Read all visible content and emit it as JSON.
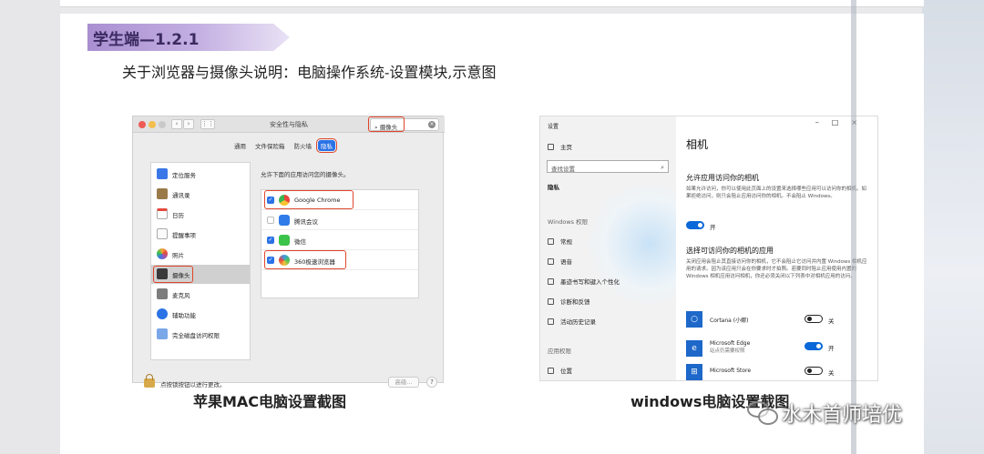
{
  "header": {
    "tag": "学生端—1.2.1",
    "subtitle": "关于浏览器与摄像头说明：电脑操作系统-设置模块,示意图"
  },
  "mac": {
    "window_title": "安全性与隐私",
    "search_value": "摄像头",
    "tabs": [
      "通用",
      "文件保险箱",
      "防火墙",
      "隐私"
    ],
    "active_tab": "隐私",
    "sidebar": [
      {
        "label": "定位服务",
        "color": "#3b78e7"
      },
      {
        "label": "通讯录",
        "color": "#9b7a4a"
      },
      {
        "label": "日历",
        "color": "#e44a3c"
      },
      {
        "label": "提醒事项",
        "color": "#f1f1f1"
      },
      {
        "label": "照片",
        "color": "#f3a53a"
      },
      {
        "label": "摄像头",
        "color": "#3a3a3a"
      },
      {
        "label": "麦克风",
        "color": "#7d7d7d"
      },
      {
        "label": "辅助功能",
        "color": "#2b72e6"
      },
      {
        "label": "完全磁盘访问权限",
        "color": "#7aa7e8"
      }
    ],
    "selected_sidebar": "摄像头",
    "main_label": "允许下面的应用访问您的摄像头。",
    "apps": [
      {
        "name": "Google Chrome",
        "checked": true,
        "color": "#e8453c"
      },
      {
        "name": "腾讯会议",
        "checked": false,
        "color": "#2f7be8"
      },
      {
        "name": "微信",
        "checked": true,
        "color": "#3cc34a"
      },
      {
        "name": "360极速浏览器",
        "checked": true,
        "color": "#3b9be8"
      }
    ],
    "footer_text": "点按锁按钮以进行更改。",
    "advanced_label": "高级...",
    "help_label": "?"
  },
  "captions": {
    "mac": "苹果MAC电脑设置截图",
    "windows": "windows电脑设置截图"
  },
  "win": {
    "window_title": "设置",
    "home": "主页",
    "search_placeholder": "查找设置",
    "privacy": "隐私",
    "windows_perms": "Windows 权限",
    "nav": [
      "常规",
      "语音",
      "墨迹书写和键入个性化",
      "诊断和反馈",
      "活动历史记录"
    ],
    "app_perms": "应用权限",
    "location": "位置",
    "page_title": "相机",
    "allow_heading": "允许应用访问你的相机",
    "allow_desc": "如果允许访问，你可以使用此页面上的设置来选择哪些应用可以访问你的相机。如果拒绝访问，则只会阻止应用访问你的相机。不会阻止 Windows。",
    "allow_toggle_label": "开",
    "choose_heading": "选择可访问你的相机的应用",
    "choose_desc": "关闭应用会阻止其直接访问你的相机，它不会阻止它访问并内置 Windows 相机应用的请求。因为该应用只会在你要求时才拍照。若要同时阻止应用使用内置的 Windows 相机应用访问相机，你还必须关闭以下列表中对相机应用的访问。",
    "apps": [
      {
        "name": "Cortana (小娜)",
        "sub": "",
        "on": false,
        "state": "关"
      },
      {
        "name": "Microsoft Edge",
        "sub": "站点仍需要权限",
        "on": true,
        "state": "开"
      },
      {
        "name": "Microsoft Store",
        "sub": "",
        "on": false,
        "state": "关"
      }
    ],
    "colors": {
      "accent": "#0a68d8"
    }
  },
  "watermark": "水木首师培优"
}
